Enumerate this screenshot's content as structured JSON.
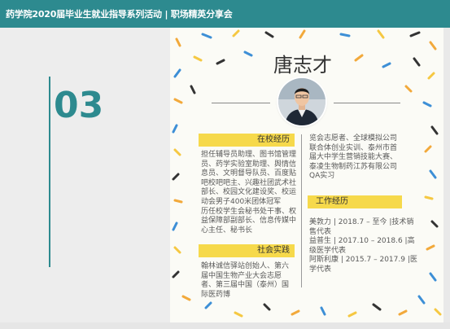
{
  "header": {
    "title": "药学院2020届毕业生就业指导系列活动 | 职场精英分享会"
  },
  "slide": {
    "number": "03",
    "person_name": "唐志才",
    "sections": {
      "campus": {
        "label": "在校经历",
        "lines": [
          "担任辅导员助理、图书馆管理",
          "员、药学实验室助理、舆情信",
          "息员、文明督导队员、百度贴",
          "吧校吧吧主、兴趣社团武术社",
          "部长、校园文化建设奖、校运",
          "动会男子400米团体冠军",
          "历任校学生会秘书处干事、权",
          "益保障部副部长、信息传媒中",
          "心主任、秘书长"
        ]
      },
      "social": {
        "label": "社会实践",
        "lines": [
          "翰林诚信驿站创始人、第六",
          "届中国生物产业大会志愿",
          "者、第三届中国（泰州）国",
          "际医药博"
        ]
      },
      "continuation": {
        "lines": [
          "览会志愿者、全球模拟公司",
          "联合体创业实训、泰州市首",
          "届大中学生营销技能大赛、",
          "泰凌生物制药江苏有限公司",
          "QA实习"
        ]
      },
      "work": {
        "label": "工作经历",
        "lines": [
          "美敦力 | 2018.7 – 至今 |技术销",
          "售代表",
          "益普生 | 2017.10 – 2018.6 |高",
          "级医学代表",
          "阿斯利康 | 2015.7 – 2017.9 |医",
          "学代表"
        ]
      }
    }
  },
  "colors": {
    "teal": "#2d8a8f",
    "yellow_tag": "#f6d94b",
    "panel_bg": "#fbfbf6",
    "left_bg": "#ededed"
  }
}
